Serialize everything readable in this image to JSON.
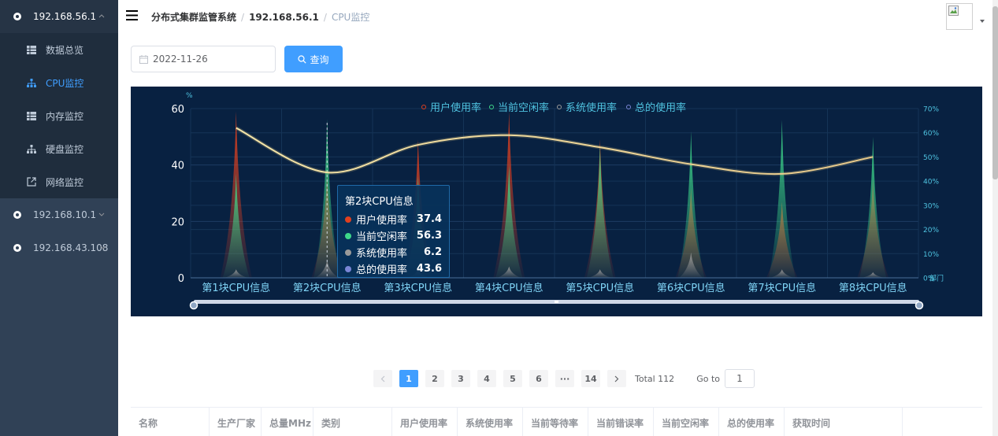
{
  "sidebar": {
    "hosts": [
      {
        "label": "192.168.56.1",
        "expanded": true
      },
      {
        "label": "192.168.10.1",
        "expanded": false
      },
      {
        "label": "192.168.43.108",
        "expanded": false
      }
    ],
    "sub_items": [
      {
        "label": "数据总览",
        "icon": "table-icon",
        "active": false
      },
      {
        "label": "CPU监控",
        "icon": "tree-icon",
        "active": true
      },
      {
        "label": "内存监控",
        "icon": "table-icon",
        "active": false
      },
      {
        "label": "硬盘监控",
        "icon": "tree-icon",
        "active": false
      },
      {
        "label": "网络监控",
        "icon": "external-link-icon",
        "active": false
      }
    ]
  },
  "header": {
    "breadcrumb": [
      "分布式集群监管系统",
      "192.168.56.1",
      "CPU监控"
    ]
  },
  "toolbar": {
    "date_value": "2022-11-26",
    "query_label": "查询"
  },
  "chart_data": {
    "type": "bar",
    "categories": [
      "第1块CPU信息",
      "第2块CPU信息",
      "第3块CPU信息",
      "第4块CPU信息",
      "第5块CPU信息",
      "第6块CPU信息",
      "第7块CPU信息",
      "第8块CPU信息"
    ],
    "series": [
      {
        "name": "用户使用率",
        "color": "#e0401f",
        "values": [
          59,
          37.4,
          49,
          59,
          49,
          32,
          27,
          35
        ]
      },
      {
        "name": "当前空闲率",
        "color": "#3ed88a",
        "values": [
          37,
          56.3,
          36,
          40,
          47,
          52,
          56,
          50
        ]
      },
      {
        "name": "系统使用率",
        "color": "#9a9a9a",
        "values": [
          3,
          6.2,
          3,
          4,
          3,
          9,
          3,
          2
        ]
      },
      {
        "name": "总的使用率",
        "color": "#7a86d6",
        "values": [
          62,
          43.6,
          55,
          59,
          54,
          47,
          43,
          50
        ]
      }
    ],
    "y_left": {
      "unit": "%",
      "ticks": [
        0,
        20,
        40,
        60
      ],
      "max": 60
    },
    "y_right": {
      "ticks": [
        "0%",
        "10%",
        "20%",
        "30%",
        "40%",
        "50%",
        "60%",
        "70%"
      ],
      "max": 70
    },
    "right_axis_label": "部门",
    "legend": "top-center",
    "grid": true
  },
  "tooltip": {
    "title": "第2块CPU信息",
    "rows": [
      {
        "label": "用户使用率",
        "value": "37.4",
        "color": "#e0401f"
      },
      {
        "label": "当前空闲率",
        "value": "56.3",
        "color": "#3ed88a"
      },
      {
        "label": "系统使用率",
        "value": "6.2",
        "color": "#9a9a9a"
      },
      {
        "label": "总的使用率",
        "value": "43.6",
        "color": "#7a86d6"
      }
    ]
  },
  "pagination": {
    "pages": [
      "1",
      "2",
      "3",
      "4",
      "5",
      "6",
      "···",
      "14"
    ],
    "current": "1",
    "total_text": "Total 112",
    "goto_label": "Go to",
    "goto_value": "1"
  },
  "table": {
    "columns": [
      "名称",
      "生产厂家",
      "总量MHz",
      "类别",
      "用户使用率",
      "系统使用率",
      "当前等待率",
      "当前错误率",
      "当前空闲率",
      "总的使用率",
      "获取时间"
    ]
  }
}
